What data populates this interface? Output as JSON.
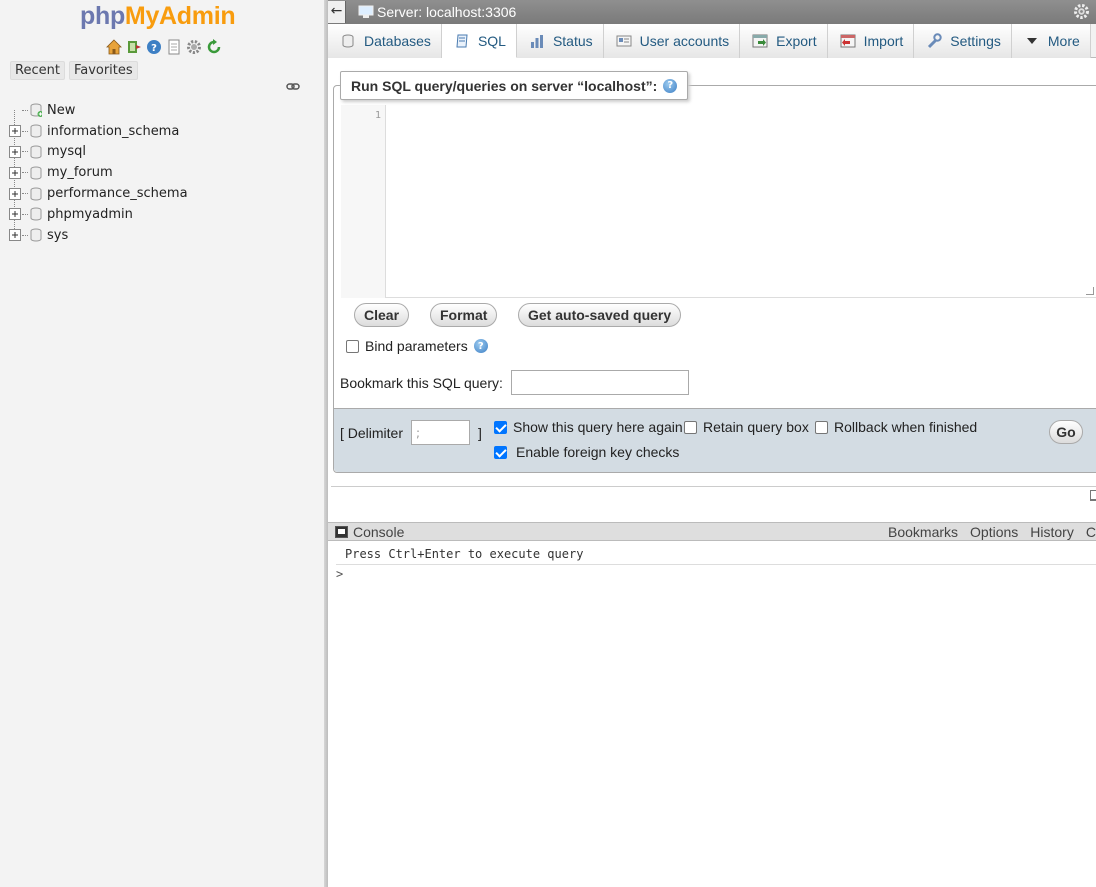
{
  "logo": {
    "php": "php",
    "myadmin": "MyAdmin"
  },
  "quick_icons": [
    "home-icon",
    "logout-icon",
    "help-icon",
    "docs-icon",
    "settings-icon",
    "reload-icon"
  ],
  "nav_tabs": {
    "recent": "Recent",
    "favorites": "Favorites"
  },
  "tree": {
    "new": "New",
    "databases": [
      "information_schema",
      "mysql",
      "my_forum",
      "performance_schema",
      "phpmyadmin",
      "sys"
    ]
  },
  "header": {
    "back": "←",
    "server": "Server: localhost:3306"
  },
  "tabs": [
    {
      "label": "Databases",
      "icon": "database-icon"
    },
    {
      "label": "SQL",
      "icon": "sql-icon",
      "active": true
    },
    {
      "label": "Status",
      "icon": "status-icon"
    },
    {
      "label": "User accounts",
      "icon": "users-icon"
    },
    {
      "label": "Export",
      "icon": "export-icon"
    },
    {
      "label": "Import",
      "icon": "import-icon"
    },
    {
      "label": "Settings",
      "icon": "wrench-icon"
    },
    {
      "label": "More",
      "icon": "dropdown-triangle-icon"
    }
  ],
  "sql": {
    "legend": "Run SQL query/queries on server “localhost”:",
    "line_number": "1",
    "query": "",
    "buttons": {
      "clear": "Clear",
      "format": "Format",
      "autosaved": "Get auto-saved query"
    },
    "bind_parameters": "Bind parameters",
    "bookmark_label": "Bookmark this SQL query:",
    "bookmark_value": ""
  },
  "footer": {
    "delimiter_open": "[ Delimiter",
    "delimiter_value": ";",
    "delimiter_close": "]",
    "show_query": {
      "label": "Show this query here again",
      "checked": true
    },
    "retain_box": {
      "label": "Retain query box",
      "checked": false
    },
    "rollback": {
      "label": "Rollback when finished",
      "checked": false
    },
    "foreign_keys": {
      "label": "Enable foreign key checks",
      "checked": true
    },
    "go": "Go"
  },
  "console": {
    "title": "Console",
    "links": [
      "Bookmarks",
      "Options",
      "History",
      "Clea"
    ],
    "message": "Press Ctrl+Enter to execute query",
    "prompt": ">"
  }
}
